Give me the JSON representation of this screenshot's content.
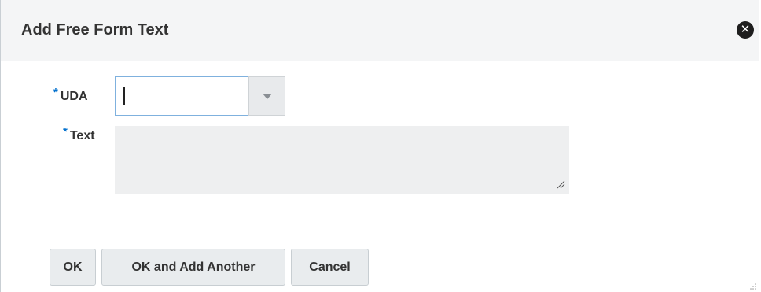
{
  "dialog": {
    "title": "Add Free Form Text",
    "close_icon": "close-circle-icon"
  },
  "form": {
    "uda": {
      "required_marker": "*",
      "label": "UDA",
      "value": "",
      "dropdown_icon": "chevron-down-icon"
    },
    "text": {
      "required_marker": "*",
      "label": "Text",
      "value": "",
      "resize_icon": "resize-handle-icon"
    }
  },
  "buttons": {
    "ok": "OK",
    "ok_and_add_another": "OK and Add Another",
    "cancel": "Cancel"
  },
  "colors": {
    "required_marker": "#0572ce",
    "input_focus_border": "#7fb1de"
  }
}
